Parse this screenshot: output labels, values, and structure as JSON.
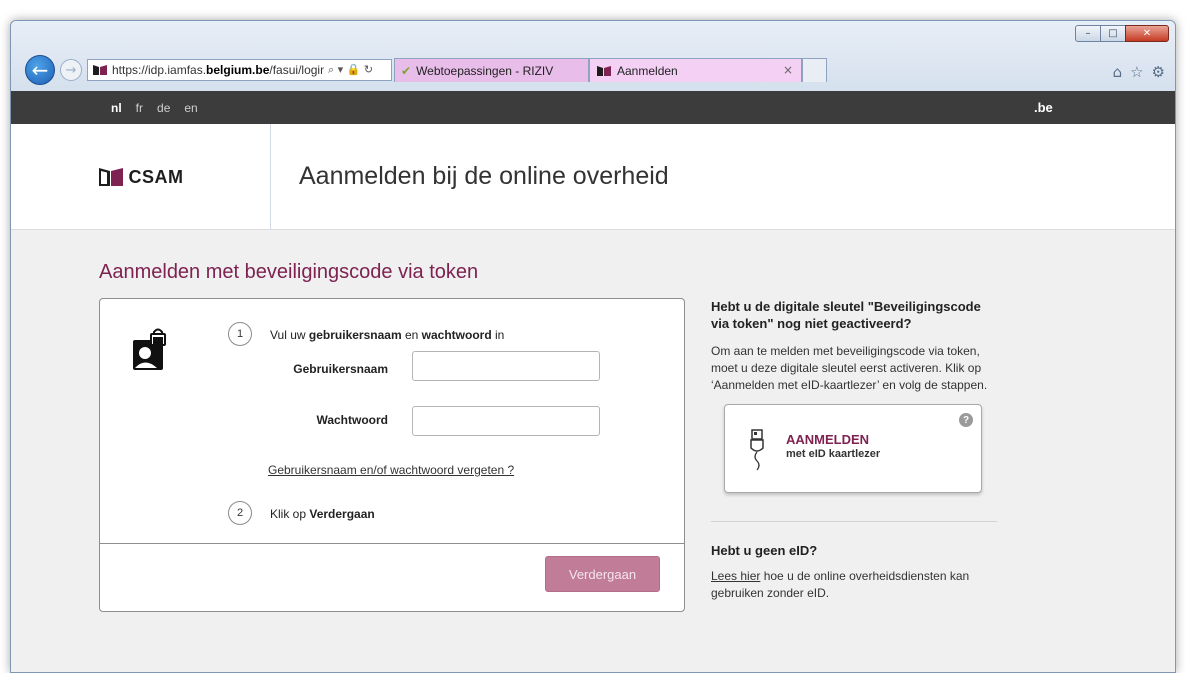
{
  "browser": {
    "url_prefix": "https://idp.iamfas.",
    "url_domain": "belgium.be",
    "url_path": "/fasui/login",
    "address_controls": "⌕ ▾ 🔒 ↻",
    "tabs": [
      {
        "label": "Webtoepassingen - RIZIV"
      },
      {
        "label": "Aanmelden",
        "close": "×"
      }
    ],
    "window_buttons": {
      "minimize": "–",
      "maximize": "□",
      "close": "✕"
    },
    "tool_icons": {
      "home": "⌂",
      "favorites": "☆",
      "settings": "⚙"
    }
  },
  "langbar": {
    "languages": [
      "nl",
      "fr",
      "de",
      "en"
    ],
    "active": "nl",
    "be_label": ".be"
  },
  "header": {
    "brand": "CSAM",
    "title": "Aanmelden bij de online overheid"
  },
  "login": {
    "heading": "Aanmelden met beveiligingscode via token",
    "step1_number": "1",
    "step1_pre": "Vul uw ",
    "step1_bold1": "gebruikersnaam",
    "step1_mid": " en ",
    "step1_bold2": "wachtwoord",
    "step1_post": " in",
    "username_label": "Gebruikersnaam",
    "username_value": "",
    "password_label": "Wachtwoord",
    "password_value": "",
    "forgot_link": "Gebruikersnaam en/of wachtwoord vergeten ?",
    "step2_number": "2",
    "step2_pre": "Klik op ",
    "step2_bold": "Verdergaan",
    "continue_button": "Verdergaan"
  },
  "sidebar": {
    "question": "Hebt u de digitale sleutel \"Beveiligingscode via token\" nog niet geactiveerd?",
    "explanation": "Om aan te melden met beveiligingscode via token, moet u deze digitale sleutel eerst activeren. Klik op ‘Aanmelden met eID-kaartlezer’ en volg de stappen.",
    "eid_button_title": "AANMELDEN",
    "eid_button_subtitle": "met eID kaartlezer",
    "help_icon": "?",
    "no_eid_question": "Hebt u geen eID?",
    "no_eid_link": "Lees hier",
    "no_eid_text": " hoe u de online overheidsdiensten kan gebruiken zonder eID."
  },
  "colors": {
    "accent": "#7d2251",
    "button": "#c17d97",
    "langbar": "#3c3c3c"
  }
}
